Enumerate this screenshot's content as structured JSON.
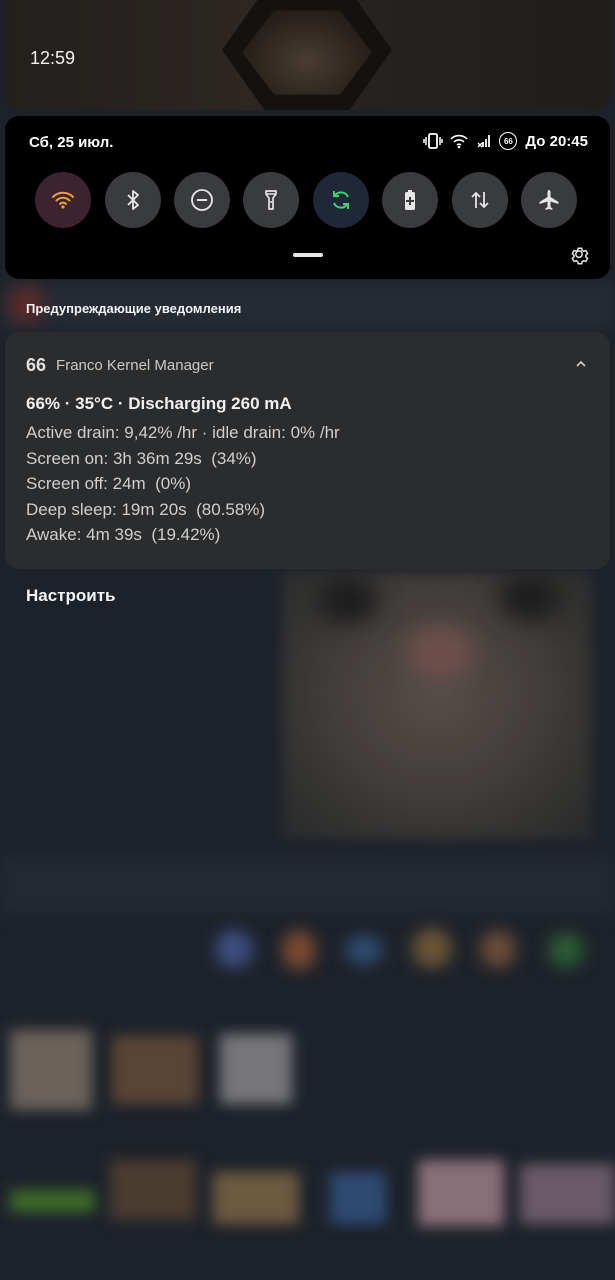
{
  "status": {
    "clock": "12:59"
  },
  "quick_settings": {
    "date": "Сб, 25 июл.",
    "status_right": "До 20:45",
    "battery_badge": "66",
    "tiles": [
      {
        "name": "wifi",
        "icon": "wifi-icon",
        "color": "#3d2330",
        "active": true
      },
      {
        "name": "bluetooth",
        "icon": "bluetooth-icon",
        "color": "#3a3b3e",
        "active": false
      },
      {
        "name": "dnd",
        "icon": "do-not-disturb-icon",
        "color": "#3a3b3e",
        "active": false
      },
      {
        "name": "flashlight",
        "icon": "flashlight-icon",
        "color": "#3a3b3e",
        "active": false
      },
      {
        "name": "autosync",
        "icon": "sync-icon",
        "color": "#1f2838",
        "active": true
      },
      {
        "name": "battery-saver",
        "icon": "battery-plus-icon",
        "color": "#3a3b3e",
        "active": false
      },
      {
        "name": "mobile-data",
        "icon": "data-arrows-icon",
        "color": "#3a3b3e",
        "active": false
      },
      {
        "name": "airplane",
        "icon": "airplane-icon",
        "color": "#3a3b3e",
        "active": false
      }
    ]
  },
  "section": {
    "title": "Предупреждающие уведомления"
  },
  "notification": {
    "badge": "66",
    "app": "Franco Kernel Manager",
    "title": "66% · 35°C · Discharging 260 mA",
    "lines": [
      "Active drain: 9,42% /hr · idle drain: 0% /hr",
      "Screen on: 3h 36m 29s  (34%)",
      "Screen off: 24m  (0%)",
      "Deep sleep: 19m 20s  (80.58%)",
      "Awake: 4m 39s  (19.42%)"
    ]
  },
  "configure": {
    "label": "Настроить"
  }
}
